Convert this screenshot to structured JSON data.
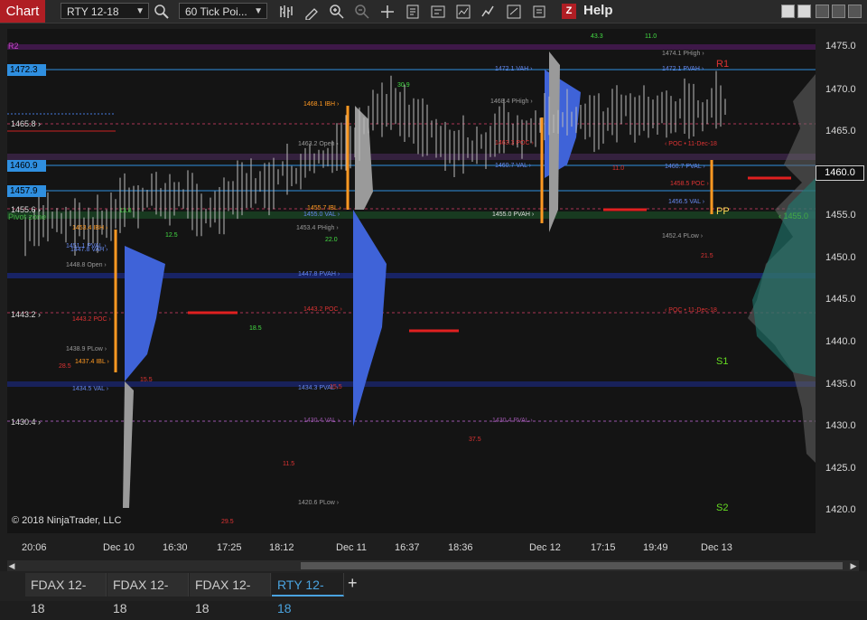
{
  "toolbar": {
    "chart_label": "Chart",
    "instrument": "RTY 12-18",
    "interval": "60 Tick Poi...",
    "help_label": "Help",
    "z_badge": "Z"
  },
  "copyright": "© 2018 NinjaTrader, LLC",
  "tabs": [
    {
      "label": "FDAX 12-18",
      "active": false
    },
    {
      "label": "FDAX 12-18",
      "active": false
    },
    {
      "label": "FDAX 12-18",
      "active": false
    },
    {
      "label": "RTY 12-18",
      "active": true
    }
  ],
  "add_tab_label": "+",
  "price_axis": {
    "ticks": [
      "1475.0",
      "1470.0",
      "1465.0",
      "1460.0",
      "1455.0",
      "1450.0",
      "1445.0",
      "1440.0",
      "1435.0",
      "1430.0",
      "1425.0",
      "1420.0"
    ],
    "current_price": "1460.0",
    "current_price_color": "#ffffff"
  },
  "time_axis": {
    "ticks": [
      "20:06",
      "Dec 10",
      "16:30",
      "17:25",
      "18:12",
      "Dec 11",
      "16:37",
      "18:36",
      "Dec 12",
      "17:15",
      "19:49",
      "Dec 13"
    ]
  },
  "left_price_tags": [
    {
      "text": "1472.3",
      "color": "#2f8fe0"
    },
    {
      "text": "1460.9",
      "color": "#2f8fe0"
    },
    {
      "text": "1457.9",
      "color": "#2f8fe0"
    }
  ],
  "left_labels": [
    "R2",
    "1465.8 ›",
    "1455.6 ›",
    "Pivot zone",
    "1443.2 ›",
    "1430.4 ›"
  ],
  "level_labels": [
    "1453.4 IBH ›",
    "1451.1 PVAL ›",
    "1447.8 VAH ›",
    "1448.8 Open ›",
    "1443.2 POC ›",
    "1438.9 PLow ›",
    "1437.4 IBL ›",
    "1434.5 VAL ›",
    "1468.1 IBH ›",
    "1463.2 Open ›",
    "1455.7 IBL ›",
    "1455.0 VAL ›",
    "1453.4 PHigh ›",
    "1447.8 PVAH ›",
    "1443.2 POC ›",
    "1434.3 PVAL ›",
    "1430.4 VAL ›",
    "1468.4 PHigh ›",
    "1463.3 POC ›",
    "1460.7 VAL ›",
    "1455.0 PVAH ›",
    "1430.4 PVAL ›",
    "1420.6 PLow ›",
    "1472.1 VAH ›",
    "1474.1 PHigh ›",
    "1472.1 PVAH ›",
    "1460.7 PVAL ›",
    "1458.5 POC ›",
    "1456.5 VAL ›",
    "1452.4 PLow ›",
    "‹ POC • 11-Dec-18",
    "‹ POC • 11-Dec-18",
    "‹ 1455.0"
  ],
  "pivot_labels": [
    "R1",
    "S1",
    "S2",
    "PP"
  ],
  "bar_counts": [
    "13.8",
    "12.5",
    "28.5",
    "15.5",
    "18.5",
    "29.5",
    "11.5",
    "30.9",
    "22.0",
    "43.3",
    "11.0",
    "37.5",
    "15.5",
    "21.5",
    "11.0"
  ]
}
